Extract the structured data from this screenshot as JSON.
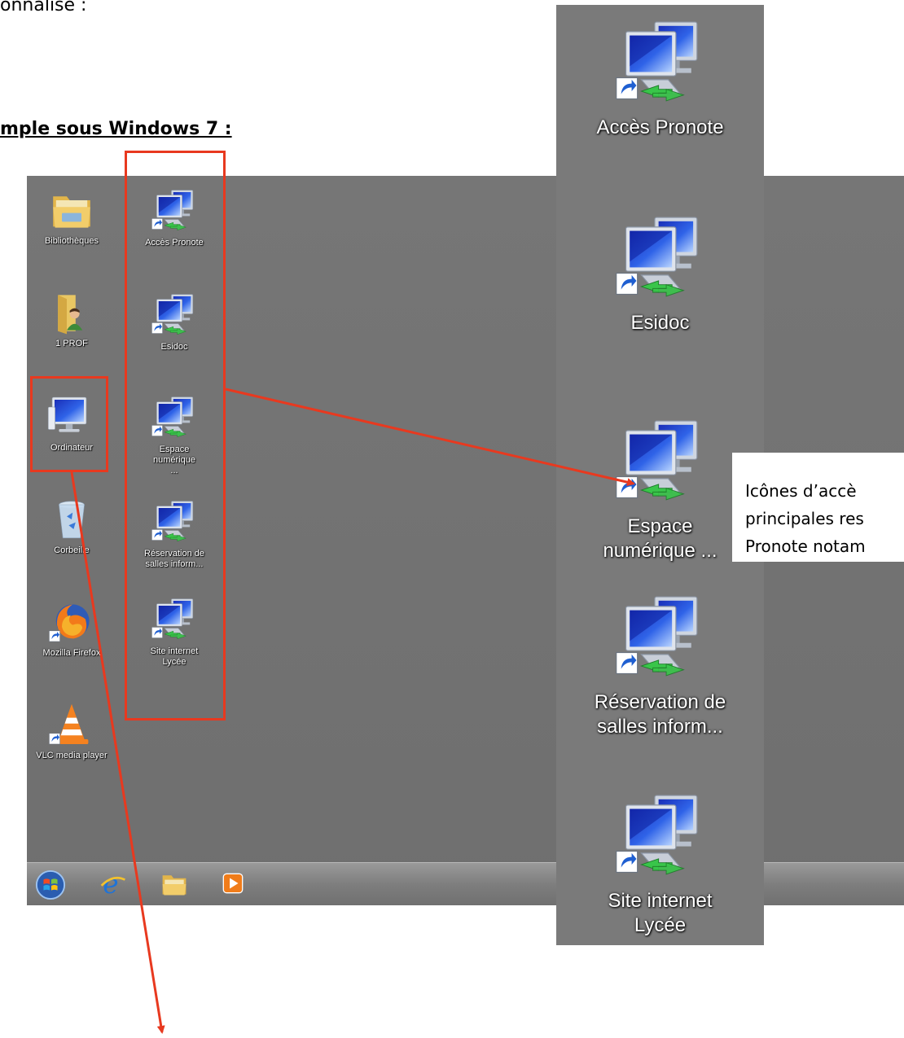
{
  "document": {
    "intro_fragment": "onnalisé :",
    "heading": "mple sous Windows 7 :",
    "callout_lines": [
      "Icônes d’accè",
      "principales res",
      "Pronote notam"
    ]
  },
  "desktop": {
    "left_column": [
      {
        "label": "Bibliothèques",
        "icon": "libraries-icon"
      },
      {
        "label": "1 PROF",
        "icon": "user-folder-icon"
      },
      {
        "label": "Ordinateur",
        "icon": "computer-icon"
      },
      {
        "label": "Corbeille",
        "icon": "recycle-bin-icon"
      },
      {
        "label": "Mozilla Firefox",
        "icon": "firefox-icon"
      },
      {
        "label": "VLC media player",
        "icon": "vlc-icon"
      }
    ],
    "shortcut_column": [
      {
        "label": "Accès Pronote",
        "icon": "network-shortcut-icon"
      },
      {
        "label": "Esidoc",
        "icon": "network-shortcut-icon"
      },
      {
        "label": "Espace numérique ...",
        "icon": "network-shortcut-icon"
      },
      {
        "label": "Réservation de salles inform...",
        "icon": "network-shortcut-icon"
      },
      {
        "label": "Site internet Lycée",
        "icon": "network-shortcut-icon"
      }
    ],
    "taskbar": [
      "start-orb-icon",
      "internet-explorer-icon",
      "explorer-folder-icon",
      "media-player-icon"
    ]
  },
  "zoom": {
    "items": [
      {
        "label": "Accès Pronote"
      },
      {
        "label": "Esidoc"
      },
      {
        "label": "Espace numérique ..."
      },
      {
        "label": "Réservation de salles inform..."
      },
      {
        "label": "Site internet Lycée"
      }
    ]
  },
  "colors": {
    "highlight": "#e8391f",
    "desktop": "#767676"
  }
}
